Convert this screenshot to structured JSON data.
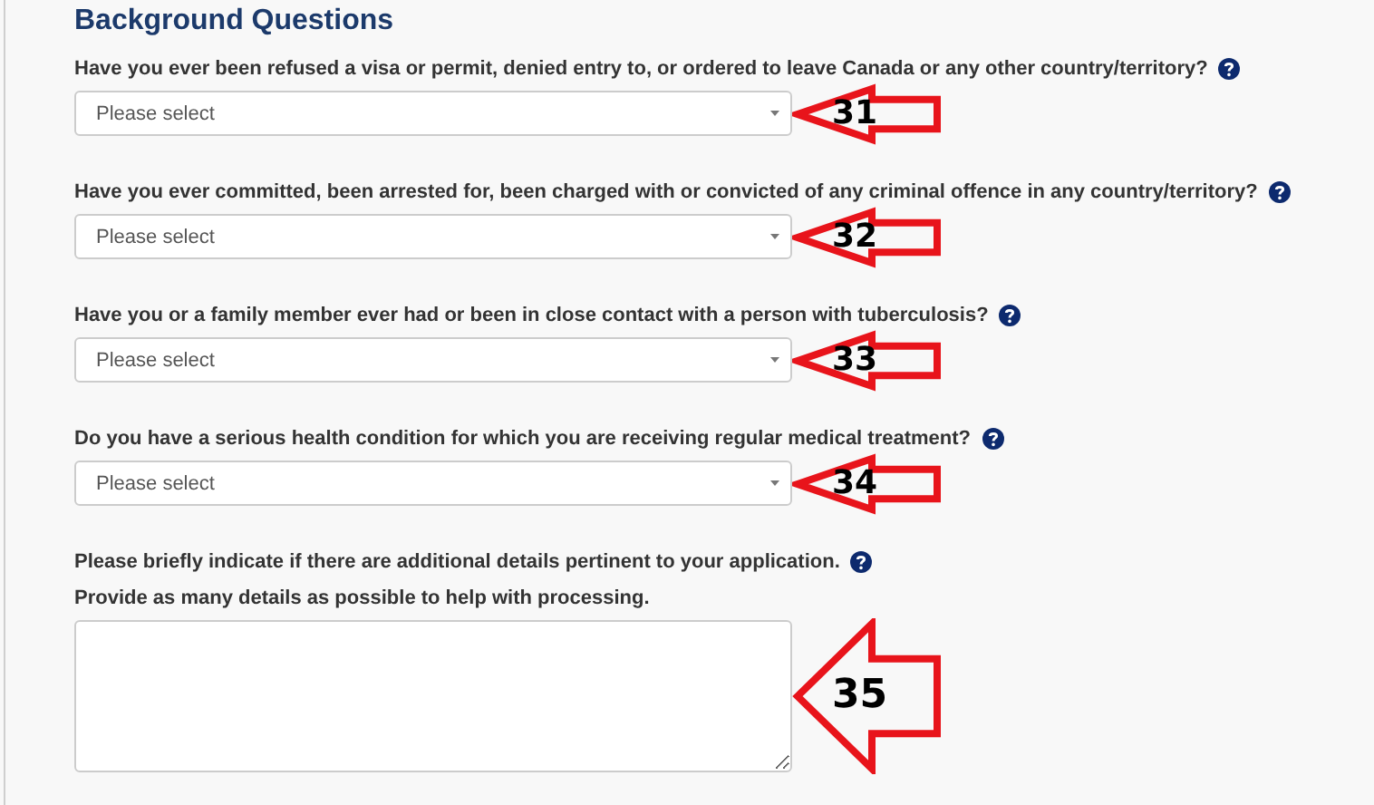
{
  "section_title": "Background Questions",
  "questions": [
    {
      "kind": "select",
      "label": "Have you ever been refused a visa or permit, denied entry to, or ordered to leave Canada or any other country/territory?",
      "help": true,
      "placeholder": "Please select",
      "marker": "31"
    },
    {
      "kind": "select",
      "label": "Have you ever committed, been arrested for, been charged with or convicted of any criminal offence in any country/territory?",
      "help": true,
      "placeholder": "Please select",
      "marker": "32"
    },
    {
      "kind": "select",
      "label": "Have you or a family member ever had or been in close contact with a person with tuberculosis?",
      "help": true,
      "placeholder": "Please select",
      "marker": "33"
    },
    {
      "kind": "select",
      "label": "Do you have a serious health condition for which you are receiving regular medical treatment?",
      "help": true,
      "placeholder": "Please select",
      "marker": "34"
    },
    {
      "kind": "textarea",
      "label": "Please briefly indicate if there are additional details pertinent to your application.",
      "help": true,
      "hint": "Provide as many details as possible to help with processing.",
      "marker": "35"
    }
  ]
}
